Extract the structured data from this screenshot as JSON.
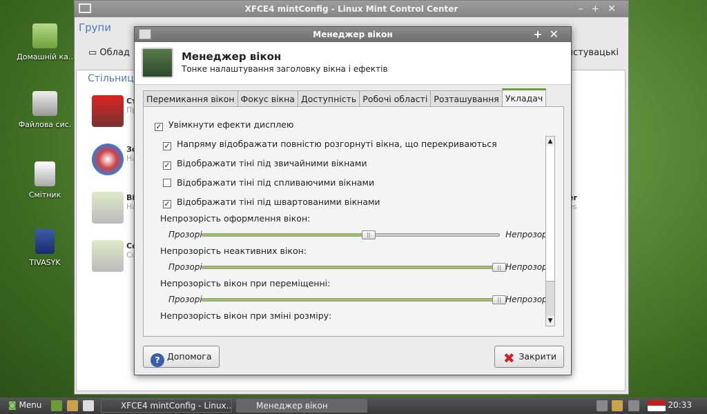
{
  "desktop": {
    "icons": [
      {
        "label": "Домашній ка.."
      },
      {
        "label": "Файлова сис."
      },
      {
        "label": "Смітник"
      },
      {
        "label": "TIVASYK"
      }
    ]
  },
  "bgwindow": {
    "title": "XFCE4 mintConfig - Linux Mint Control Center",
    "groups": "Групи",
    "toolbar_left": "Облад",
    "toolbar_right": "ристувацькі",
    "section": "Стільниц",
    "items": [
      {
        "title": "Сті",
        "sub": "Пр"
      },
      {
        "title": "Зов",
        "sub": "На"
      },
      {
        "title": "Вік",
        "sub": "На"
      },
      {
        "title": "Со",
        "sub": "Со"
      }
    ],
    "right_bits": [
      "er",
      "es"
    ]
  },
  "dialog": {
    "title": "Менеджер вікон",
    "header_title": "Менеджер вікон",
    "header_sub": "Тонке налаштування заголовку вікна і ефектів",
    "tabs": [
      "Перемикання вікон",
      "Фокус вікна",
      "Доступність",
      "Робочі області",
      "Розташування",
      "Укладач"
    ],
    "enable_effects": {
      "label": "Увімкнути ефекти дисплею",
      "checked": true
    },
    "options": [
      {
        "label": "Напряму відображати повністю розгорнуті вікна, що перекриваються",
        "checked": true
      },
      {
        "label": "Відображати тіні під звичайними вікнами",
        "checked": true
      },
      {
        "label": "Відображати тіні під спливаючими вікнами",
        "checked": false
      },
      {
        "label": "Відображати тіні під швартованими вікнами",
        "checked": true
      }
    ],
    "sliders": [
      {
        "label": "Непрозорість оформлення вікон:",
        "min": "Прозорі",
        "max": "Непрозорі",
        "value": 0.56
      },
      {
        "label": "Непрозорість неактивних вікон:",
        "min": "Прозорі",
        "max": "Непрозорі",
        "value": 1.0
      },
      {
        "label": "Непрозорість вікон при переміщенні:",
        "min": "Прозорі",
        "max": "Непрозорі",
        "value": 1.0
      }
    ],
    "last_label": "Непрозорість вікон при зміні розміру:",
    "help": "Допомога",
    "close": "Закрити"
  },
  "taskbar": {
    "menu": "Menu",
    "tasks": [
      "XFCE4 mintConfig - Linux...",
      "Менеджер вікон"
    ],
    "clock": "20:33"
  }
}
